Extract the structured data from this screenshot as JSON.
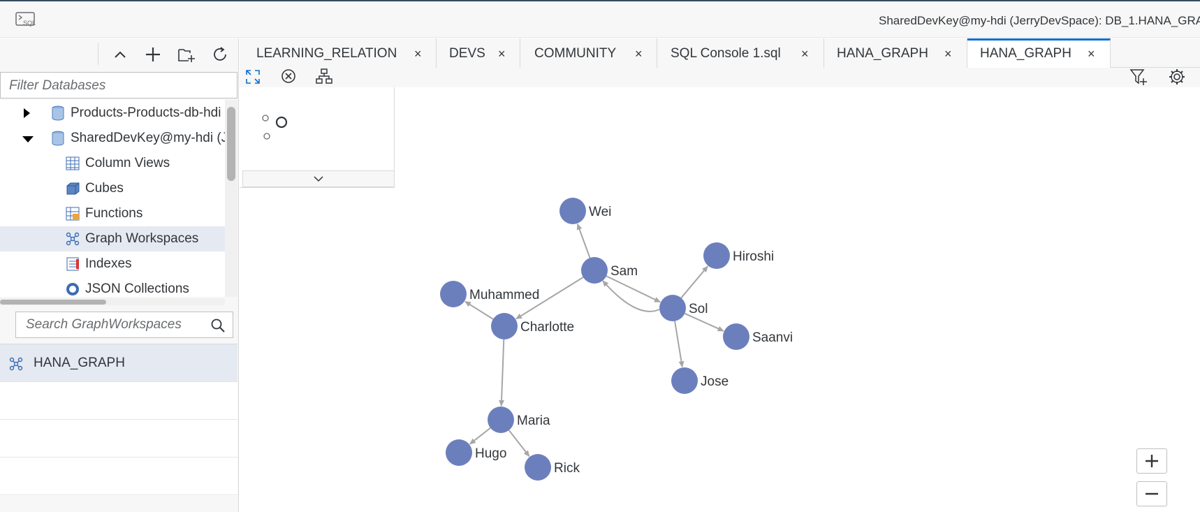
{
  "window": {
    "connection_title": "SharedDevKey@my-hdi (JerryDevSpace): DB_1.HANA_GRA"
  },
  "icons": {
    "sql_console": "sql-console-icon",
    "collapse": "chevron-up-icon",
    "add": "plus-icon",
    "add_folder": "add-folder-icon",
    "refresh": "refresh-icon",
    "database": "database-icon",
    "column_views": "table-icon",
    "cubes": "cube-icon",
    "functions": "function-icon",
    "graph_workspaces": "graph-icon",
    "indexes": "index-icon",
    "json": "json-icon",
    "search": "search-icon",
    "fullscreen": "expand-icon",
    "clear": "close-circle-icon",
    "layout": "hierarchy-icon",
    "filter": "filter-add-icon",
    "settings": "gear-icon",
    "zoom_in": "plus-icon",
    "zoom_out": "minus-icon"
  },
  "sidebar": {
    "filter_placeholder": "Filter Databases",
    "tree": [
      {
        "label": "Products-Products-db-hdi",
        "expanded": false
      },
      {
        "label": "SharedDevKey@my-hdi (JerryDevSpace)",
        "expanded": true
      },
      {
        "label": "Column Views"
      },
      {
        "label": "Cubes"
      },
      {
        "label": "Functions"
      },
      {
        "label": "Graph Workspaces",
        "selected": true
      },
      {
        "label": "Indexes"
      },
      {
        "label": "JSON Collections"
      }
    ],
    "search_placeholder": "Search GraphWorkspaces",
    "workspaces": [
      {
        "label": "HANA_GRAPH"
      }
    ]
  },
  "tabs": [
    {
      "label": "LEARNING_RELATION",
      "close": "×"
    },
    {
      "label": "DEVS",
      "close": "×"
    },
    {
      "label": "COMMUNITY",
      "close": "×"
    },
    {
      "label": "SQL Console 1.sql",
      "close": "×"
    },
    {
      "label": "HANA_GRAPH",
      "close": "×"
    },
    {
      "label": "HANA_GRAPH",
      "close": "×",
      "active": true
    }
  ],
  "graph": {
    "node_color": "#6c7fbd",
    "edge_color": "#a6a6a6",
    "nodes": [
      {
        "id": "wei",
        "label": "Wei"
      },
      {
        "id": "sam",
        "label": "Sam"
      },
      {
        "id": "hiroshi",
        "label": "Hiroshi"
      },
      {
        "id": "muhammed",
        "label": "Muhammed"
      },
      {
        "id": "charlotte",
        "label": "Charlotte"
      },
      {
        "id": "sol",
        "label": "Sol"
      },
      {
        "id": "saanvi",
        "label": "Saanvi"
      },
      {
        "id": "jose",
        "label": "Jose"
      },
      {
        "id": "maria",
        "label": "Maria"
      },
      {
        "id": "hugo",
        "label": "Hugo"
      },
      {
        "id": "rick",
        "label": "Rick"
      }
    ],
    "edges": [
      {
        "from": "sam",
        "to": "wei"
      },
      {
        "from": "sam",
        "to": "sol"
      },
      {
        "from": "sol",
        "to": "sam"
      },
      {
        "from": "sam",
        "to": "charlotte"
      },
      {
        "from": "charlotte",
        "to": "muhammed"
      },
      {
        "from": "charlotte",
        "to": "maria"
      },
      {
        "from": "sol",
        "to": "hiroshi"
      },
      {
        "from": "sol",
        "to": "saanvi"
      },
      {
        "from": "sol",
        "to": "jose"
      },
      {
        "from": "maria",
        "to": "hugo"
      },
      {
        "from": "maria",
        "to": "rick"
      }
    ]
  }
}
